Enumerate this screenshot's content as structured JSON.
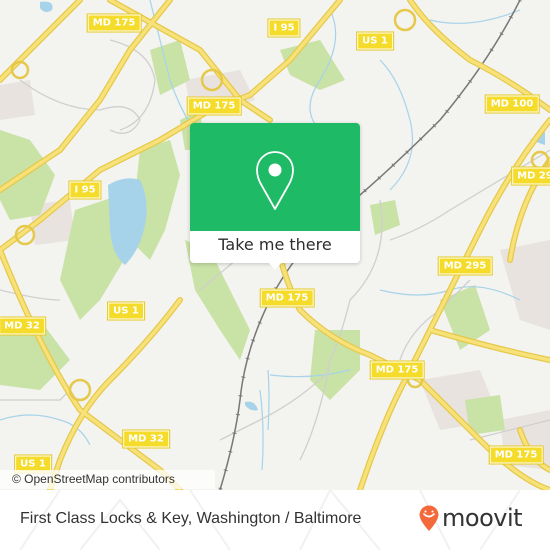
{
  "map": {
    "attribution": "© OpenStreetMap contributors",
    "colors": {
      "background": "#f3f3ef",
      "road_major": "#f5dc4a",
      "road_casing": "#e8c84a",
      "water": "#a6d3ea",
      "park": "#c9e2a6",
      "rail": "#777777",
      "minor_road": "#cccccc",
      "developed": "#e9e3df"
    },
    "route_shields": [
      {
        "label": "MD 175"
      },
      {
        "label": "I 95"
      },
      {
        "label": "US 1"
      },
      {
        "label": "MD 175"
      },
      {
        "label": "MD 100"
      },
      {
        "label": "I 95"
      },
      {
        "label": "MD 295"
      },
      {
        "label": "MD 175"
      },
      {
        "label": "US 1"
      },
      {
        "label": "MD 32"
      },
      {
        "label": "MD 175"
      },
      {
        "label": "MD 32"
      },
      {
        "label": "MD 175"
      },
      {
        "label": "US 1"
      }
    ]
  },
  "popup": {
    "action_label": "Take me there",
    "icon": "map-pin-icon",
    "color": "#1fba66"
  },
  "footer": {
    "place_title": "First Class Locks & Key, Washington / Baltimore",
    "brand": "moovit",
    "brand_icon": "moovit-pin-smile-icon",
    "brand_color": "#f26a3c"
  }
}
